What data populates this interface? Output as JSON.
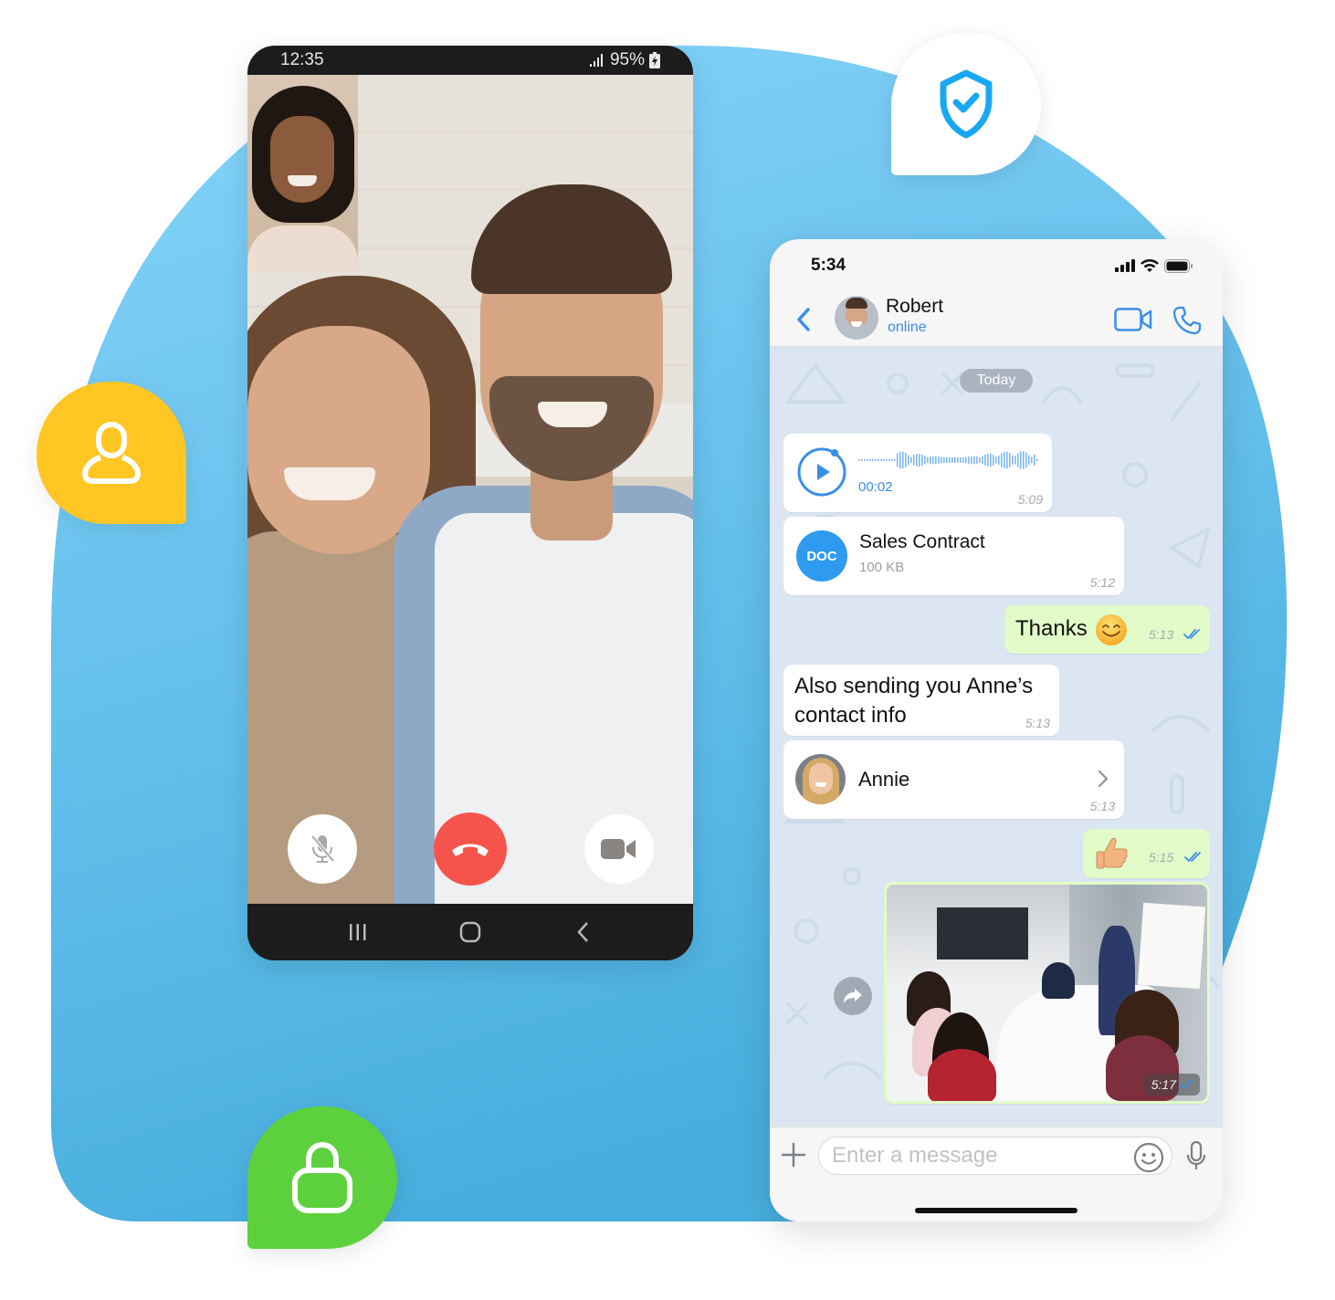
{
  "colors": {
    "blob_light": "#86d4fa",
    "blob_dark": "#47aede",
    "badge_yellow": "#ffc624",
    "badge_green": "#5cd13d",
    "shield_blue": "#1aa7f2",
    "end_call_red": "#f5544c",
    "ios_accent": "#3a8ee6",
    "outgoing_bubble": "#e1fcc9",
    "chat_bg": "#dbe6f2",
    "doc_blue": "#2e9af0"
  },
  "badges": {
    "shield": {
      "icon": "shield-check-icon"
    },
    "user": {
      "icon": "user-icon"
    },
    "lock": {
      "icon": "lock-icon"
    }
  },
  "android": {
    "status_time": "12:35",
    "battery": "95%",
    "icons": {
      "signal": "signal-icon",
      "battery": "battery-charging-icon"
    },
    "call_controls": {
      "mute": {
        "icon": "mic-off-icon",
        "label": "Mute"
      },
      "end": {
        "icon": "end-call-icon",
        "label": "End call"
      },
      "video": {
        "icon": "video-camera-icon",
        "label": "Camera"
      }
    },
    "nav": {
      "recents": "recents-icon",
      "home": "home-icon",
      "back": "back-icon"
    }
  },
  "ios": {
    "status_time": "5:34",
    "icons": {
      "signal": "signal-icon",
      "wifi": "wifi-icon",
      "battery": "battery-icon"
    },
    "header": {
      "contact_name": "Robert",
      "contact_status": "online",
      "icons": {
        "back": "chevron-left-icon",
        "video": "video-call-icon",
        "phone": "phone-icon"
      }
    },
    "date_chip": "Today",
    "messages": [
      {
        "type": "audio",
        "direction": "incoming",
        "duration": "00:02",
        "time": "5:09"
      },
      {
        "type": "document",
        "direction": "incoming",
        "badge": "DOC",
        "name": "Sales Contract",
        "size": "100 KB",
        "time": "5:12"
      },
      {
        "type": "text",
        "direction": "outgoing",
        "text": "Thanks",
        "emoji": "smiling-face-emoji",
        "time": "5:13",
        "status": "read"
      },
      {
        "type": "text",
        "direction": "incoming",
        "text": "Also sending you Anne’s contact info",
        "time": "5:13"
      },
      {
        "type": "contact",
        "direction": "incoming",
        "name": "Annie",
        "time": "5:13"
      },
      {
        "type": "emoji",
        "direction": "outgoing",
        "emoji": "thumbs-up-emoji",
        "time": "5:15",
        "status": "read"
      },
      {
        "type": "photo",
        "direction": "outgoing",
        "description": "Team meeting in conference room",
        "time": "5:17",
        "status": "sent"
      }
    ],
    "composer": {
      "placeholder": "Enter a message",
      "value": "",
      "icons": {
        "attach": "plus-icon",
        "emoji": "emoji-icon",
        "mic": "microphone-icon"
      }
    }
  }
}
